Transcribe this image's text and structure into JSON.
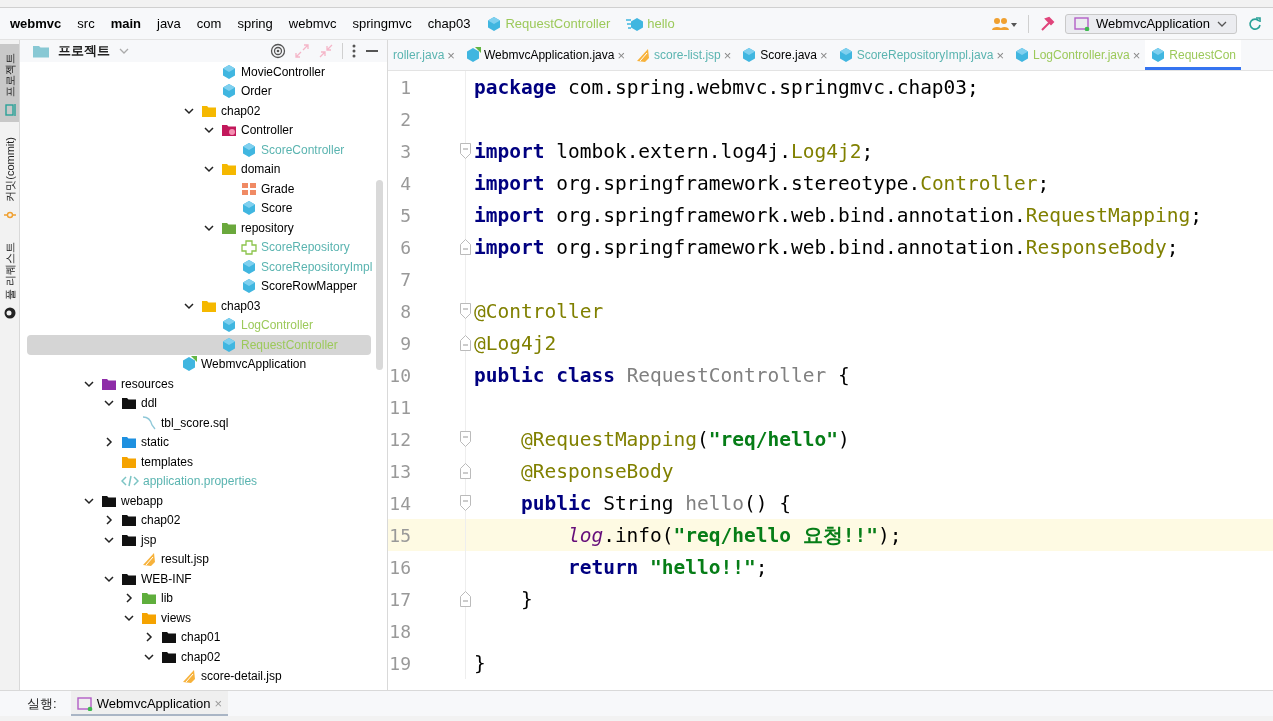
{
  "breadcrumb": [
    {
      "label": "webmvc",
      "kind": "module"
    },
    {
      "label": "src",
      "kind": "dir"
    },
    {
      "label": "main",
      "kind": "root"
    },
    {
      "label": "java",
      "kind": "dir"
    },
    {
      "label": "com",
      "kind": "dir"
    },
    {
      "label": "spring",
      "kind": "dir"
    },
    {
      "label": "webmvc",
      "kind": "dir"
    },
    {
      "label": "springmvc",
      "kind": "dir"
    },
    {
      "label": "chap03",
      "kind": "dir"
    },
    {
      "label": "RequestController",
      "kind": "class",
      "color": "#9cc95a"
    },
    {
      "label": "hello",
      "kind": "method",
      "color": "#9cc95a"
    }
  ],
  "toolbar": {
    "run_config": "WebmvcApplication"
  },
  "tool_stripe": [
    {
      "label": "프로젝트",
      "kind": "project",
      "selected": true
    },
    {
      "label": "커밋(commit)",
      "kind": "commit",
      "selected": false
    },
    {
      "label": "풀 리퀘스트",
      "kind": "pull",
      "selected": false
    }
  ],
  "project_panel": {
    "title": "프로젝트"
  },
  "tree": {
    "items": [
      {
        "children": [
          {
            "children": [
              {
                "children": [
                  {
                    "children": [
                      {
                        "children": [
                          {
                            "children": [
                              {
                                "label": "MovieController",
                                "kind": "class",
                                "selected": false
                              },
                              {
                                "label": "Order",
                                "kind": "class",
                                "selected": false
                              }
                            ]
                          },
                          {
                            "label": "chap02",
                            "kind": "package",
                            "selected": false,
                            "expanded": true,
                            "children": [
                              {
                                "label": "Controller",
                                "kind": "controller",
                                "selected": false,
                                "expanded": true,
                                "children": [
                                  {
                                    "label": "ScoreController",
                                    "kind": "class",
                                    "color": "#5ab4b0",
                                    "selected": false
                                  }
                                ]
                              },
                              {
                                "label": "domain",
                                "kind": "package",
                                "selected": false,
                                "expanded": true,
                                "children": [
                                  {
                                    "label": "Grade",
                                    "kind": "enum",
                                    "selected": false
                                  },
                                  {
                                    "label": "Score",
                                    "kind": "class",
                                    "selected": false
                                  }
                                ]
                              },
                              {
                                "label": "repository",
                                "kind": "repository",
                                "selected": false,
                                "expanded": true,
                                "children": [
                                  {
                                    "label": "ScoreRepository",
                                    "kind": "interface",
                                    "color": "#5ab4b0",
                                    "selected": false
                                  },
                                  {
                                    "label": "ScoreRepositoryImpl",
                                    "kind": "class",
                                    "color": "#5ab4b0",
                                    "selected": false
                                  },
                                  {
                                    "label": "ScoreRowMapper",
                                    "kind": "class",
                                    "selected": false
                                  }
                                ]
                              }
                            ]
                          },
                          {
                            "label": "chap03",
                            "kind": "package",
                            "selected": false,
                            "expanded": true,
                            "children": [
                              {
                                "label": "LogController",
                                "kind": "class",
                                "color": "#9cc95a",
                                "selected": false
                              },
                              {
                                "label": "RequestController",
                                "kind": "class",
                                "color": "#9cc95a",
                                "selected": true
                              }
                            ]
                          }
                        ]
                      },
                      {
                        "label": "WebmvcApplication",
                        "kind": "app",
                        "selected": false
                      }
                    ]
                  }
                ]
              }
            ]
          }
        ]
      },
      {
        "label": "resources",
        "kind": "resources",
        "selected": false,
        "expanded": true,
        "children": [
          {
            "label": "ddl",
            "kind": "folder",
            "selected": false,
            "expanded": true,
            "children": [
              {
                "label": "tbl_score.sql",
                "kind": "sql",
                "selected": false
              }
            ]
          },
          {
            "label": "static",
            "kind": "static",
            "selected": false,
            "expanded": false
          },
          {
            "label": "templates",
            "kind": "templates",
            "selected": false
          },
          {
            "label": "application.properties",
            "kind": "properties",
            "color": "#5ab4b0",
            "selected": false
          }
        ]
      },
      {
        "label": "webapp",
        "kind": "folder",
        "selected": false,
        "expanded": true,
        "children": [
          {
            "label": "chap02",
            "kind": "folder",
            "selected": false,
            "expanded": false
          },
          {
            "label": "jsp",
            "kind": "folder",
            "selected": false,
            "expanded": true,
            "children": [
              {
                "label": "result.jsp",
                "kind": "jsp",
                "selected": false
              }
            ]
          },
          {
            "label": "WEB-INF",
            "kind": "folder",
            "selected": false,
            "expanded": true,
            "children": [
              {
                "label": "lib",
                "kind": "lib",
                "selected": false,
                "expanded": false
              },
              {
                "label": "views",
                "kind": "templates",
                "selected": false,
                "expanded": true,
                "children": [
                  {
                    "label": "chap01",
                    "kind": "folder",
                    "selected": false,
                    "expanded": false
                  },
                  {
                    "label": "chap02",
                    "kind": "folder",
                    "selected": false,
                    "expanded": true,
                    "children": [
                      {
                        "label": "score-detail.jsp",
                        "kind": "jsp",
                        "selected": false
                      }
                    ]
                  }
                ]
              }
            ]
          }
        ]
      }
    ]
  },
  "editor_tabs": [
    {
      "label": "roller.java",
      "kind": "cut",
      "color": "#5ab4b0",
      "selected": false,
      "close": "×"
    },
    {
      "label": "WebmvcApplication.java",
      "kind": "app",
      "selected": false,
      "close": "×"
    },
    {
      "label": "score-list.jsp",
      "kind": "jsp",
      "color": "#5ab4b0",
      "selected": false,
      "close": "×"
    },
    {
      "label": "Score.java",
      "kind": "class",
      "selected": false,
      "close": "×"
    },
    {
      "label": "ScoreRepositoryImpl.java",
      "kind": "class",
      "color": "#5ab4b0",
      "selected": false,
      "close": "×"
    },
    {
      "label": "LogController.java",
      "kind": "class",
      "color": "#9cc95a",
      "selected": false,
      "close": "×"
    },
    {
      "label": "RequestCon",
      "kind": "class",
      "color": "#9cc95a",
      "selected": true
    }
  ],
  "code": {
    "lines": [
      {
        "number": "1",
        "current": false,
        "tokens": [
          {
            "kind": "keyword",
            "text": "package"
          },
          {
            "kind": "plain",
            "text": " com.spring.webmvc.springmvc.chap03;"
          }
        ]
      },
      {
        "number": "2",
        "current": false
      },
      {
        "number": "3",
        "current": false,
        "kind": "fold-start",
        "tokens": [
          {
            "kind": "keyword",
            "text": "import"
          },
          {
            "kind": "plain",
            "text": " lombok.extern.log4j."
          },
          {
            "kind": "type",
            "text": "Log4j2"
          },
          {
            "kind": "plain",
            "text": ";"
          }
        ]
      },
      {
        "number": "4",
        "current": false,
        "tokens": [
          {
            "kind": "keyword",
            "text": "import"
          },
          {
            "kind": "plain",
            "text": " org.springframework.stereotype."
          },
          {
            "kind": "type",
            "text": "Controller"
          },
          {
            "kind": "plain",
            "text": ";"
          }
        ]
      },
      {
        "number": "5",
        "current": false,
        "tokens": [
          {
            "kind": "keyword",
            "text": "import"
          },
          {
            "kind": "plain",
            "text": " org.springframework.web.bind.annotation."
          },
          {
            "kind": "type",
            "text": "RequestMapping"
          },
          {
            "kind": "plain",
            "text": ";"
          }
        ]
      },
      {
        "number": "6",
        "current": false,
        "kind": "fold-end",
        "tokens": [
          {
            "kind": "keyword",
            "text": "import"
          },
          {
            "kind": "plain",
            "text": " org.springframework.web.bind.annotation."
          },
          {
            "kind": "type",
            "text": "ResponseBody"
          },
          {
            "kind": "plain",
            "text": ";"
          }
        ]
      },
      {
        "number": "7",
        "current": false
      },
      {
        "number": "8",
        "current": false,
        "kind": "fold-start",
        "tokens": [
          {
            "kind": "annotation",
            "text": "@Controller"
          }
        ]
      },
      {
        "number": "9",
        "current": false,
        "kind": "fold-end",
        "tokens": [
          {
            "kind": "annotation",
            "text": "@Log4j2"
          }
        ]
      },
      {
        "number": "10",
        "current": false,
        "tokens": [
          {
            "kind": "keyword",
            "text": "public class"
          },
          {
            "kind": "unused",
            "text": " RequestController"
          },
          {
            "kind": "plain",
            "text": " {"
          }
        ]
      },
      {
        "number": "11",
        "current": false
      },
      {
        "number": "12",
        "current": false,
        "kind": "fold-start",
        "tokens": [
          {
            "kind": "annotation",
            "text": "    @RequestMapping"
          },
          {
            "kind": "plain",
            "text": "("
          },
          {
            "kind": "string",
            "text": "\"req/hello\""
          },
          {
            "kind": "plain",
            "text": ")"
          }
        ]
      },
      {
        "number": "13",
        "current": false,
        "kind": "fold-end",
        "tokens": [
          {
            "kind": "annotation",
            "text": "    @ResponseBody"
          }
        ]
      },
      {
        "number": "14",
        "current": false,
        "kind": "fold-start",
        "tokens": [
          {
            "kind": "keyword",
            "text": "    public"
          },
          {
            "kind": "plain",
            "text": " String "
          },
          {
            "kind": "unused",
            "text": "hello"
          },
          {
            "kind": "plain",
            "text": "() {"
          }
        ]
      },
      {
        "number": "15",
        "current": true,
        "tokens": [
          {
            "kind": "field",
            "text": "        log"
          },
          {
            "kind": "plain",
            "text": ".info("
          },
          {
            "kind": "string",
            "text": "\"req/hello 요청!!\""
          },
          {
            "kind": "plain",
            "text": ");"
          }
        ]
      },
      {
        "number": "16",
        "current": false,
        "tokens": [
          {
            "kind": "keyword",
            "text": "        return"
          },
          {
            "kind": "string",
            "text": " \"hello!!\""
          },
          {
            "kind": "plain",
            "text": ";"
          }
        ]
      },
      {
        "number": "17",
        "current": false,
        "kind": "fold-end",
        "tokens": [
          {
            "kind": "plain",
            "text": "    }"
          }
        ]
      },
      {
        "number": "18",
        "current": false
      },
      {
        "number": "19",
        "current": false,
        "tokens": [
          {
            "kind": "plain",
            "text": "}"
          }
        ]
      }
    ]
  },
  "run_bar": {
    "label": "실행:",
    "tabs": [
      {
        "label": "WebmvcApplication",
        "selected": true,
        "close": "×"
      }
    ]
  }
}
